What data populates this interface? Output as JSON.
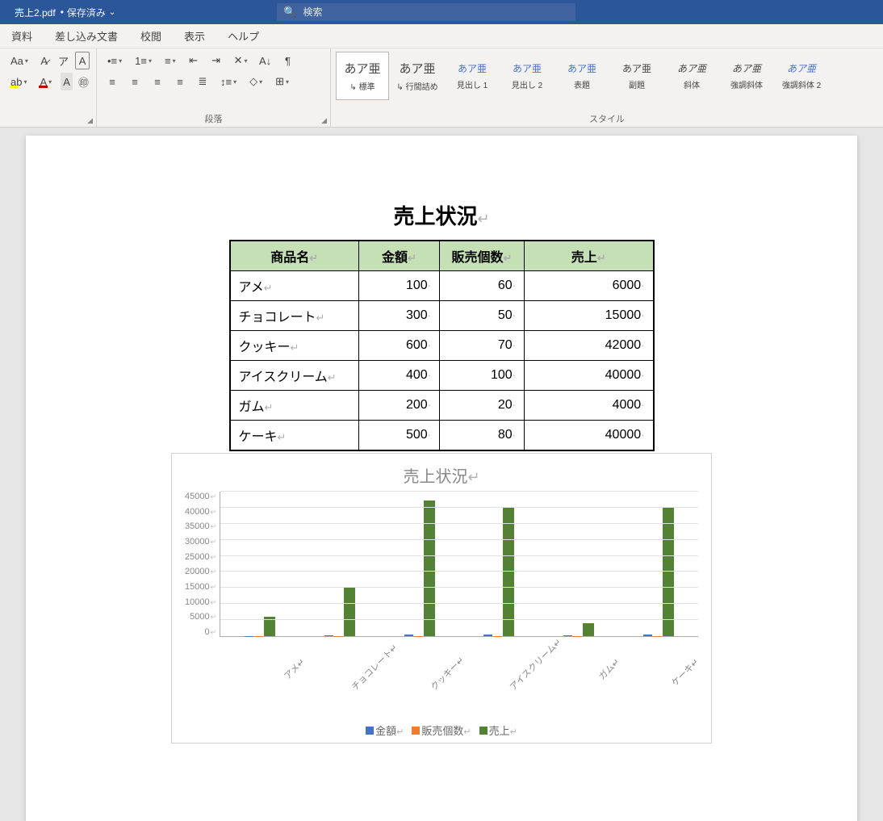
{
  "titlebar": {
    "filename": "売上2.pdf",
    "saved_label": "保存済み",
    "search_placeholder": "検索"
  },
  "tabs": [
    "資料",
    "差し込み文書",
    "校閲",
    "表示",
    "ヘルプ"
  ],
  "ribbon": {
    "paragraph_label": "段落",
    "styles_label": "スタイル",
    "styles": [
      {
        "preview": "あア亜",
        "name": "標準"
      },
      {
        "preview": "あア亜",
        "name": "行間詰め"
      },
      {
        "preview": "あア亜",
        "name": "見出し 1"
      },
      {
        "preview": "あア亜",
        "name": "見出し 2"
      },
      {
        "preview": "あア亜",
        "name": "表題"
      },
      {
        "preview": "あア亜",
        "name": "副題"
      },
      {
        "preview": "あア亜",
        "name": "斜体"
      },
      {
        "preview": "あア亜",
        "name": "強調斜体"
      },
      {
        "preview": "あア亜",
        "name": "強調斜体 2"
      }
    ]
  },
  "doc": {
    "title": "売上状況",
    "headers": [
      "商品名",
      "金額",
      "販売個数",
      "売上"
    ],
    "rows": [
      {
        "name": "アメ",
        "price": "100",
        "qty": "60",
        "sales": "6000"
      },
      {
        "name": "チョコレート",
        "price": "300",
        "qty": "50",
        "sales": "15000"
      },
      {
        "name": "クッキー",
        "price": "600",
        "qty": "70",
        "sales": "42000"
      },
      {
        "name": "アイスクリーム",
        "price": "400",
        "qty": "100",
        "sales": "40000"
      },
      {
        "name": "ガム",
        "price": "200",
        "qty": "20",
        "sales": "4000"
      },
      {
        "name": "ケーキ",
        "price": "500",
        "qty": "80",
        "sales": "40000"
      }
    ]
  },
  "chart_data": {
    "type": "bar",
    "title": "売上状況",
    "categories": [
      "アメ",
      "チョコレート",
      "クッキー",
      "アイスクリーム",
      "ガム",
      "ケーキ"
    ],
    "series": [
      {
        "name": "金額",
        "values": [
          100,
          300,
          600,
          400,
          200,
          500
        ],
        "color": "#4472c4"
      },
      {
        "name": "販売個数",
        "values": [
          60,
          50,
          70,
          100,
          20,
          80
        ],
        "color": "#ed7d31"
      },
      {
        "name": "売上",
        "values": [
          6000,
          15000,
          42000,
          40000,
          4000,
          40000
        ],
        "color": "#548235"
      }
    ],
    "ylabel": "",
    "xlabel": "",
    "ylim": [
      0,
      45000
    ],
    "yticks": [
      0,
      5000,
      10000,
      15000,
      20000,
      25000,
      30000,
      35000,
      40000,
      45000
    ]
  }
}
